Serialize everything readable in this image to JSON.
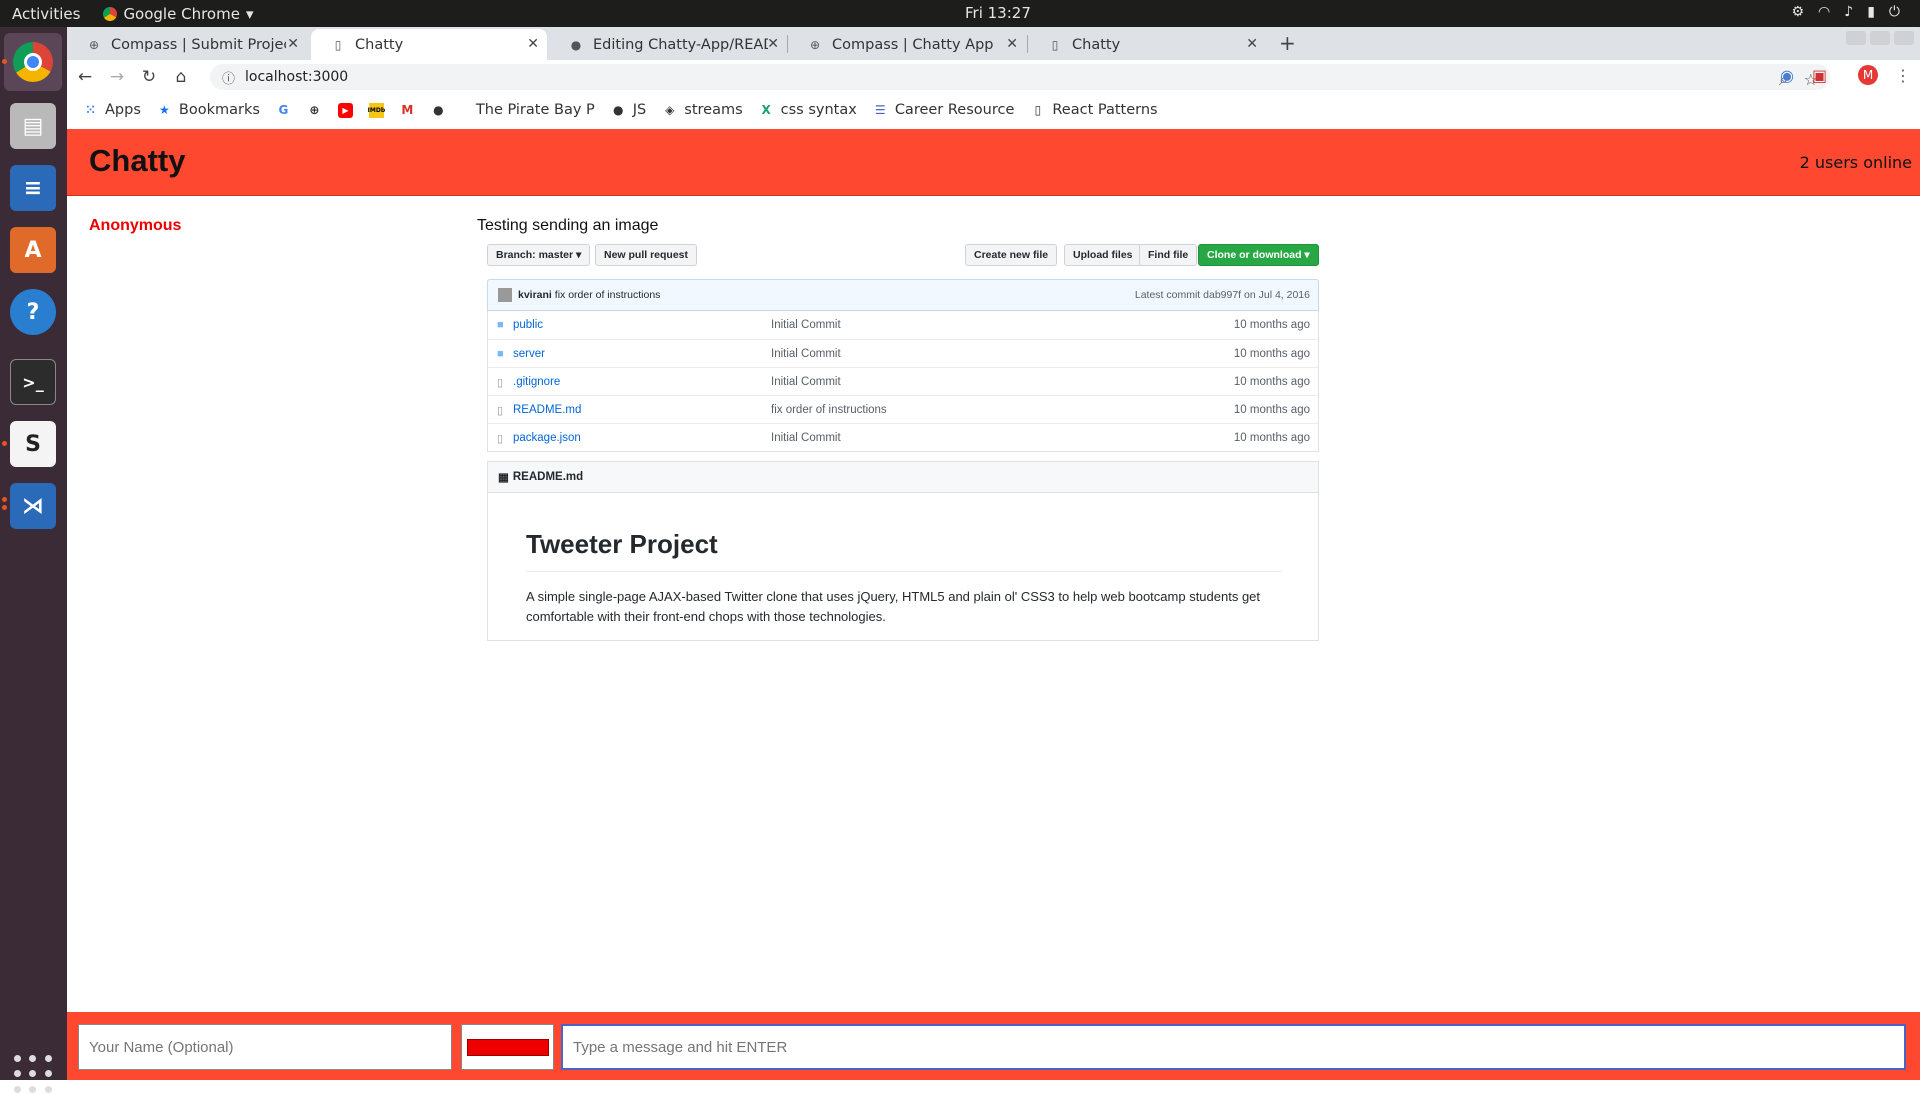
{
  "os_bar": {
    "activities": "Activities",
    "app_name": "Google Chrome",
    "clock": "Fri 13:27"
  },
  "tabs": [
    {
      "label": "Compass | Submit Project",
      "icon": "globe-icon"
    },
    {
      "label": "Chatty",
      "icon": "page-icon",
      "active": true
    },
    {
      "label": "Editing Chatty-App/READ",
      "icon": "github-icon"
    },
    {
      "label": "Compass | Chatty App",
      "icon": "globe-icon"
    },
    {
      "label": "Chatty",
      "icon": "page-icon"
    }
  ],
  "address_bar": {
    "url": "localhost:3000"
  },
  "bookmarks": [
    {
      "label": "Apps",
      "icon": "apps-grid-icon"
    },
    {
      "label": "Bookmarks",
      "icon": "star-icon"
    },
    {
      "label": "",
      "icon": "google-icon"
    },
    {
      "label": "",
      "icon": "compass-icon"
    },
    {
      "label": "",
      "icon": "youtube-icon"
    },
    {
      "label": "",
      "icon": "imdb-icon"
    },
    {
      "label": "",
      "icon": "gmail-icon"
    },
    {
      "label": "",
      "icon": "github-icon"
    },
    {
      "label": "The Pirate Bay P",
      "icon": ""
    },
    {
      "label": "JS",
      "icon": "github-icon"
    },
    {
      "label": "streams",
      "icon": "diamond-icon"
    },
    {
      "label": "css syntax",
      "icon": "x-logo-icon"
    },
    {
      "label": "Career Resource",
      "icon": "doc-icon"
    },
    {
      "label": "React Patterns",
      "icon": "page-icon"
    }
  ],
  "app": {
    "brand": "Chatty",
    "users_online": "2 users online",
    "message": {
      "username": "Anonymous",
      "text": "Testing sending an image",
      "user_color": "#e00000"
    },
    "name_placeholder": "Your Name (Optional)",
    "message_placeholder": "Type a message and hit ENTER",
    "accent_color": "#ff4830"
  },
  "image": {
    "branch_label": "Branch: master ▾",
    "new_pr": "New pull request",
    "create_file": "Create new file",
    "upload_files": "Upload files",
    "find_file": "Find file",
    "clone": "Clone or download ▾",
    "commit_author": "kvirani",
    "commit_message": "fix order of instructions",
    "latest_commit": "Latest commit dab997f on Jul 4, 2016",
    "files": [
      {
        "name": "public",
        "type": "folder",
        "message": "Initial Commit",
        "age": "10 months ago"
      },
      {
        "name": "server",
        "type": "folder",
        "message": "Initial Commit",
        "age": "10 months ago"
      },
      {
        "name": ".gitignore",
        "type": "file",
        "message": "Initial Commit",
        "age": "10 months ago"
      },
      {
        "name": "README.md",
        "type": "file",
        "message": "fix order of instructions",
        "age": "10 months ago"
      },
      {
        "name": "package.json",
        "type": "file",
        "message": "Initial Commit",
        "age": "10 months ago"
      }
    ],
    "readme_label": "README.md",
    "readme_title": "Tweeter Project",
    "readme_desc": "A simple single-page AJAX-based Twitter clone that uses jQuery, HTML5 and plain ol' CSS3 to help web bootcamp students get comfortable with their front-end chops with those technologies."
  }
}
